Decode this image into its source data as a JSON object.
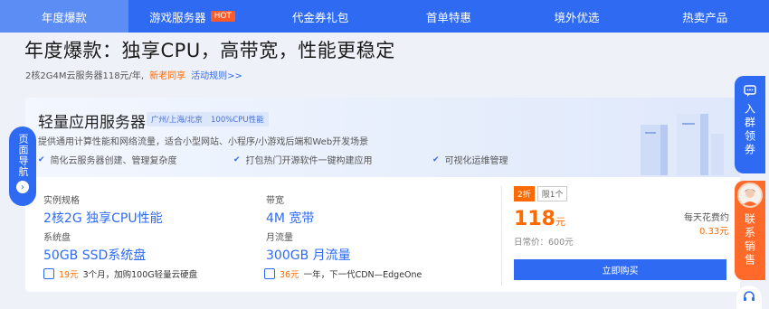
{
  "nav": {
    "tabs": [
      {
        "label": "年度爆款"
      },
      {
        "label": "游戏服务器",
        "badge": "HOT"
      },
      {
        "label": "代金券礼包"
      },
      {
        "label": "首单特惠"
      },
      {
        "label": "境外优选"
      },
      {
        "label": "热卖产品"
      }
    ]
  },
  "headline": "年度爆款：独享CPU，高带宽，性能更稳定",
  "subline": {
    "text": "2核2G4M云服务器118元/年,",
    "highlight": "新老同享",
    "link": "活动规则>>"
  },
  "product": {
    "title": "轻量应用服务器",
    "tags": [
      "广州/上海/北京",
      "100%CPU性能"
    ],
    "description": "提供通用计算性能和网络流量，适合小型网站、小程序/小游戏后端和Web开发场景",
    "features": [
      "简化云服务器创建、管理复杂度",
      "打包热门开源软件一键构建应用",
      "可视化运维管理"
    ],
    "specs": [
      {
        "label": "实例规格",
        "value": "2核2G 独享CPU性能"
      },
      {
        "label": "带宽",
        "value": "4M 宽带"
      },
      {
        "label": "系统盘",
        "value": "50GB SSD系统盘"
      },
      {
        "label": "月流量",
        "value": "300GB 月流量"
      }
    ],
    "options": [
      {
        "price": "19元",
        "text": "3个月，加购100G轻量云硬盘"
      },
      {
        "price": "36元",
        "text": "一年，下一代CDN—EdgeOne"
      }
    ],
    "discount_badge": "2折",
    "limit_badge": "限1个",
    "price": "118",
    "price_unit": "元",
    "original_price": "日常价：600元",
    "daily_label": "每天花费约",
    "daily_value": "0.33元",
    "buy_label": "立即购买"
  },
  "side_nav": {
    "label": "页面导航",
    "arrow": "›"
  },
  "right_tabs": {
    "group": "入群领券",
    "sales": "联系销售"
  },
  "colors": {
    "primary": "#2f6bf2",
    "accent": "#ff6a00",
    "hot": "#ff5a2a"
  }
}
